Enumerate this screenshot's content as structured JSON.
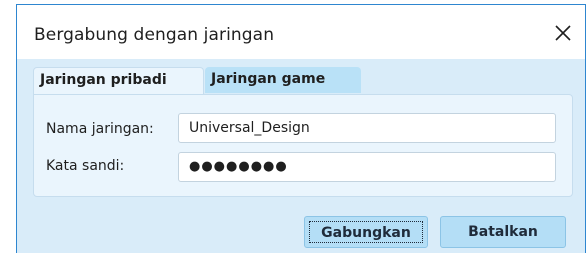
{
  "window": {
    "title": "Bergabung dengan jaringan"
  },
  "tabs": [
    {
      "label": "Jaringan pribadi",
      "active": true
    },
    {
      "label": "Jaringan game",
      "active": false
    }
  ],
  "form": {
    "network_name_label": "Nama jaringan:",
    "network_name_value": "Universal_Design",
    "password_label": "Kata sandi:",
    "password_mask": "●●●●●●●●"
  },
  "buttons": {
    "join_label": "Gabungkan",
    "cancel_label": "Batalkan"
  },
  "icons": {
    "close": "close-icon"
  },
  "colors": {
    "window_border": "#2e86d0",
    "body_background": "#d9ecf9",
    "panel_background": "#eaf5fd",
    "inactive_tab": "#b9e1f7",
    "button": "#b4def6"
  }
}
